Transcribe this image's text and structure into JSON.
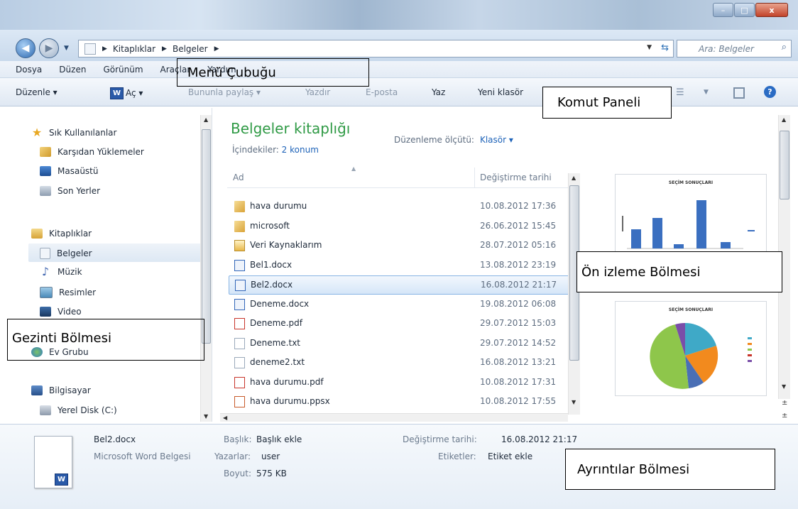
{
  "window": {
    "buttons": {
      "minimize": "–",
      "maximize": "□",
      "close": "x"
    }
  },
  "address": {
    "crumbs": [
      "Kitaplıklar",
      "Belgeler"
    ],
    "search_placeholder": "Ara: Belgeler"
  },
  "menu": {
    "items": [
      "Dosya",
      "Düzen",
      "Görünüm",
      "Araçlar",
      "Yardım"
    ]
  },
  "toolbar": {
    "organize": "Düzenle ▾",
    "open": "Aç ▾",
    "share": "Bununla paylaş ▾",
    "print": "Yazdır",
    "email": "E-posta",
    "burn": "Yaz",
    "new_folder": "Yeni klasör",
    "help": "?"
  },
  "nav": {
    "favorites": "Sık Kullanılanlar",
    "downloads": "Karşıdan Yüklemeler",
    "desktop": "Masaüstü",
    "recent": "Son Yerler",
    "libraries": "Kitaplıklar",
    "documents": "Belgeler",
    "music": "Müzik",
    "pictures": "Resimler",
    "videos": "Video",
    "homegroup": "Ev Grubu",
    "computer": "Bilgisayar",
    "local_disk": "Yerel Disk (C:)"
  },
  "files": {
    "title": "Belgeler kitaplığı",
    "includes_label": "İçindekiler:",
    "includes_value": "2 konum",
    "arrange_label": "Düzenleme ölçütü:",
    "arrange_value": "Klasör ▾",
    "col_name": "Ad",
    "col_date": "Değiştirme tarihi",
    "rows": [
      {
        "name": "hava durumu",
        "date": "10.08.2012 17:36",
        "type": "folder"
      },
      {
        "name": "microsoft",
        "date": "26.06.2012 15:45",
        "type": "folder"
      },
      {
        "name": "Veri Kaynaklarım",
        "date": "28.07.2012 05:16",
        "type": "data"
      },
      {
        "name": "Bel1.docx",
        "date": "13.08.2012 23:19",
        "type": "word"
      },
      {
        "name": "Bel2.docx",
        "date": "16.08.2012 21:17",
        "type": "word"
      },
      {
        "name": "Deneme.docx",
        "date": "19.08.2012 06:08",
        "type": "word"
      },
      {
        "name": "Deneme.pdf",
        "date": "29.07.2012 15:03",
        "type": "pdf"
      },
      {
        "name": "Deneme.txt",
        "date": "29.07.2012 14:52",
        "type": "txt"
      },
      {
        "name": "deneme2.txt",
        "date": "16.08.2012 13:21",
        "type": "txt"
      },
      {
        "name": "hava durumu.pdf",
        "date": "10.08.2012 17:31",
        "type": "pdf"
      },
      {
        "name": "hava durumu.ppsx",
        "date": "10.08.2012 17:55",
        "type": "pps"
      }
    ]
  },
  "preview": {
    "chart_title": "SEÇİM SONUÇLARI"
  },
  "details": {
    "filename": "Bel2.docx",
    "filetype": "Microsoft Word Belgesi",
    "title_label": "Başlık:",
    "title_value": "Başlık ekle",
    "authors_label": "Yazarlar:",
    "authors_value": "user",
    "size_label": "Boyut:",
    "size_value": "575 KB",
    "modified_label": "Değiştirme tarihi:",
    "modified_value": "16.08.2012 21:17",
    "tags_label": "Etiketler:",
    "tags_value": "Etiket ekle"
  },
  "annotations": {
    "menu_bar": "Menü Çubuğu",
    "command_panel": "Komut Paneli",
    "preview_pane": "Ön izleme Bölmesi",
    "nav_pane": "Gezinti Bölmesi",
    "details_pane": "Ayrıntılar Bölmesi"
  },
  "colors": {
    "library_title": "#2f9a45",
    "link": "#1d62b8",
    "selection": "#d5e6f8"
  }
}
